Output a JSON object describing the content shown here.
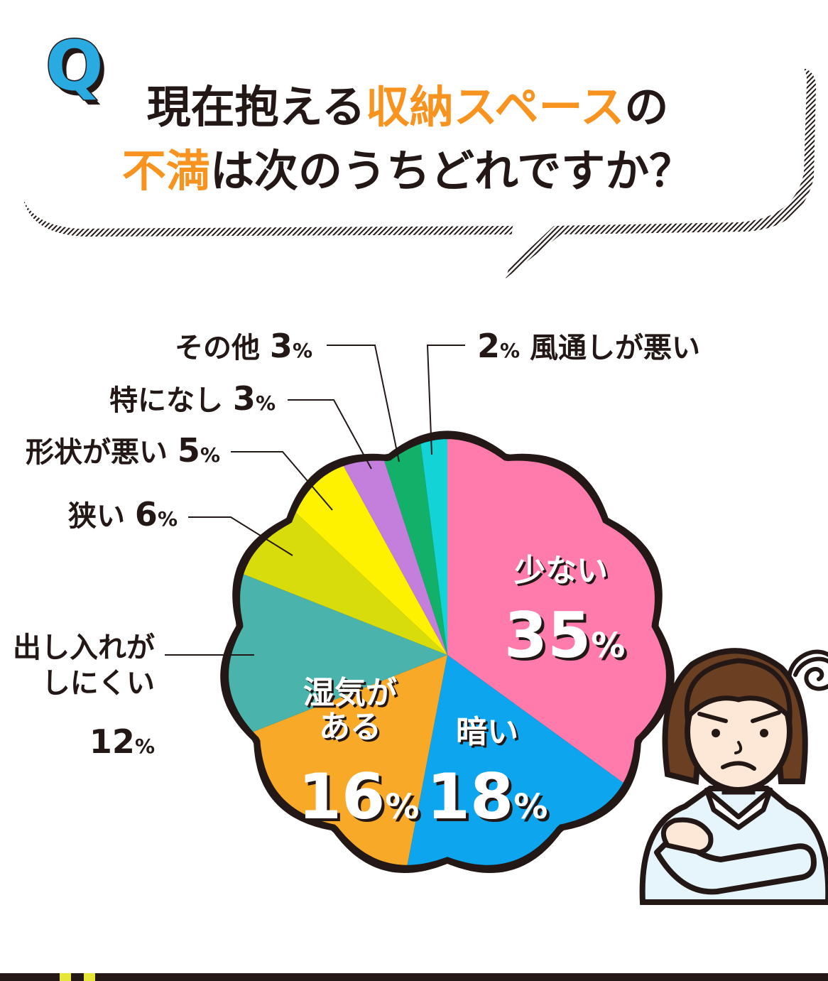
{
  "question": {
    "q_mark": "Q",
    "line1": [
      {
        "text": "現在抱える",
        "highlight": false
      },
      {
        "text": "収納スペース",
        "highlight": true
      },
      {
        "text": "の",
        "highlight": false
      }
    ],
    "line2": [
      {
        "text": "不満",
        "highlight": true
      },
      {
        "text": "は次のうちどれですか？",
        "highlight": false
      }
    ]
  },
  "colors": {
    "text": "#231815",
    "highlight": "#f7931e",
    "q_mark": "#29abe2",
    "outline": "#231815",
    "bottom_accent": "#e6e63a"
  },
  "chart_data": {
    "type": "pie",
    "unit": "%",
    "start": "12 o'clock, clockwise",
    "slices": [
      {
        "label": "少ない",
        "value": 35,
        "color": "#ff7bac",
        "label_position": "inside"
      },
      {
        "label": "暗い",
        "value": 18,
        "color": "#0ea5ef",
        "label_position": "inside"
      },
      {
        "label": "湿気がある",
        "label_lines": [
          "湿気が",
          "ある"
        ],
        "value": 16,
        "color": "#f9a928",
        "label_position": "inside"
      },
      {
        "label": "出し入れがしにくい",
        "label_lines": [
          "出し入れが",
          "しにくい"
        ],
        "value": 12,
        "color": "#4ab4ac",
        "label_position": "outside"
      },
      {
        "label": "狭い",
        "value": 6,
        "color": "#d9dc0b",
        "label_position": "outside"
      },
      {
        "label": "形状が悪い",
        "value": 5,
        "color": "#fff200",
        "label_position": "outside"
      },
      {
        "label": "特になし",
        "value": 3,
        "color": "#c47fdc",
        "label_position": "outside"
      },
      {
        "label": "その他",
        "value": 3,
        "color": "#12b069",
        "label_position": "outside"
      },
      {
        "label": "風通しが悪い",
        "value": 2,
        "color": "#13d3d6",
        "label_position": "outside"
      }
    ]
  }
}
